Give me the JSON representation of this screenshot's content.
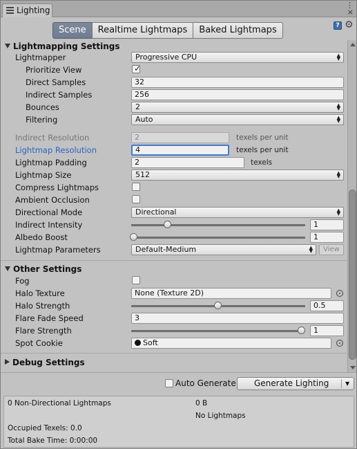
{
  "window": {
    "tab_title": "Lighting",
    "menu_dots": "⋮",
    "menu_close": "×"
  },
  "toolbar": {
    "tabs": [
      {
        "label": "Scene",
        "active": true
      },
      {
        "label": "Realtime Lightmaps",
        "active": false
      },
      {
        "label": "Baked Lightmaps",
        "active": false
      }
    ],
    "help_icon": "help-icon",
    "settings_icon": "gear-icon"
  },
  "lightmapping": {
    "title": "Lightmapping Settings",
    "lightmapper": {
      "label": "Lightmapper",
      "value": "Progressive CPU"
    },
    "prioritize_view": {
      "label": "Prioritize View",
      "checked": true
    },
    "direct_samples": {
      "label": "Direct Samples",
      "value": "32"
    },
    "indirect_samples": {
      "label": "Indirect Samples",
      "value": "256"
    },
    "bounces": {
      "label": "Bounces",
      "value": "2"
    },
    "filtering": {
      "label": "Filtering",
      "value": "Auto"
    },
    "indirect_resolution": {
      "label": "Indirect Resolution",
      "value": "2",
      "unit": "texels per unit"
    },
    "lightmap_resolution": {
      "label": "Lightmap Resolution",
      "value": "4",
      "unit": "texels per unit"
    },
    "lightmap_padding": {
      "label": "Lightmap Padding",
      "value": "2",
      "unit": "texels"
    },
    "lightmap_size": {
      "label": "Lightmap Size",
      "value": "512"
    },
    "compress_lightmaps": {
      "label": "Compress Lightmaps",
      "checked": false
    },
    "ambient_occlusion": {
      "label": "Ambient Occlusion",
      "checked": false
    },
    "directional_mode": {
      "label": "Directional Mode",
      "value": "Directional"
    },
    "indirect_intensity": {
      "label": "Indirect Intensity",
      "value": "1",
      "slider_fraction": 0.2
    },
    "albedo_boost": {
      "label": "Albedo Boost",
      "value": "1",
      "slider_fraction": 0.0
    },
    "lightmap_parameters": {
      "label": "Lightmap Parameters",
      "value": "Default-Medium",
      "button": "View"
    }
  },
  "other": {
    "title": "Other Settings",
    "fog": {
      "label": "Fog",
      "checked": false
    },
    "halo_texture": {
      "label": "Halo Texture",
      "value": "None (Texture 2D)"
    },
    "halo_strength": {
      "label": "Halo Strength",
      "value": "0.5",
      "slider_fraction": 0.5
    },
    "flare_fade_speed": {
      "label": "Flare Fade Speed",
      "value": "3"
    },
    "flare_strength": {
      "label": "Flare Strength",
      "value": "1",
      "slider_fraction": 1.0
    },
    "spot_cookie": {
      "label": "Spot Cookie",
      "value": "Soft"
    }
  },
  "debug": {
    "title": "Debug Settings"
  },
  "bottom": {
    "auto_generate": {
      "label": "Auto Generate",
      "checked": false
    },
    "generate_button": "Generate Lighting"
  },
  "stats": {
    "non_directional": "0 Non-Directional Lightmaps",
    "size": "0 B",
    "no_lightmaps": "No Lightmaps",
    "occupied_texels": "Occupied Texels: 0.0",
    "total_bake_time": "Total Bake Time: 0:00:00"
  },
  "colors": {
    "accent": "#3d7bd6",
    "selected_label": "#2a63c8",
    "active_tab": "#75869a"
  }
}
